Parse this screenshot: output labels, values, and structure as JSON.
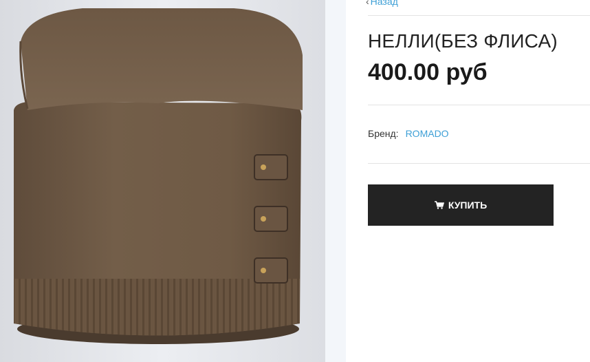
{
  "nav": {
    "back_label": "Назад"
  },
  "product": {
    "title": "НЕЛЛИ(БЕЗ ФЛИСА)",
    "price": "400.00 руб",
    "brand_label": "Бренд:",
    "brand_value": "ROMADO",
    "image_alt": "brown knitted hat"
  },
  "actions": {
    "buy_label": "КУПИТЬ",
    "buy_icon": "cart-icon"
  },
  "colors": {
    "accent": "#3d9fd6",
    "button_bg": "#232323",
    "hat_brown": "#6e5a46"
  }
}
